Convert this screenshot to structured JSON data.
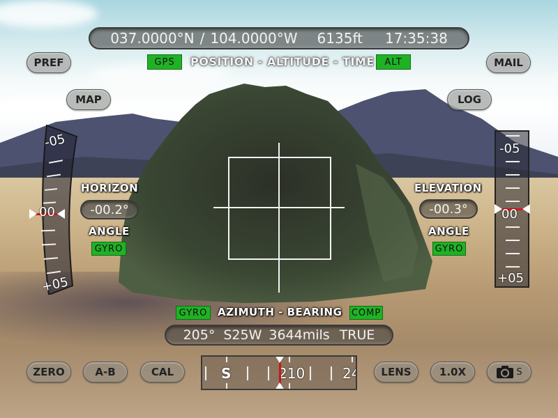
{
  "status_bar": {
    "latitude": "037.0000°N",
    "separator": "/",
    "longitude": "104.0000°W",
    "altitude": "6135ft",
    "time": "17:35:38"
  },
  "position_header": {
    "gps_tag": "GPS",
    "title": "POSITION - ALTITUDE - TIME",
    "alt_tag": "ALT"
  },
  "nav_buttons": {
    "pref": "PREF",
    "map": "MAP",
    "mail": "MAIL",
    "log": "LOG"
  },
  "horizon": {
    "title": "HORIZON",
    "value": "-00.2°",
    "subtitle": "ANGLE",
    "source_tag": "GYRO",
    "scale_labels": {
      "top": "-05",
      "center": "00",
      "bottom": "+05"
    },
    "angle_degrees": -0.2
  },
  "elevation": {
    "title": "ELEVATION",
    "value": "-00.3°",
    "subtitle": "ANGLE",
    "source_tag": "GYRO",
    "scale_labels": {
      "top": "-05",
      "center": "00",
      "bottom": "+05"
    },
    "angle_degrees": -0.3
  },
  "azimuth": {
    "gyro_tag": "GYRO",
    "title": "AZIMUTH - BEARING",
    "comp_tag": "COMP",
    "degrees": "205°",
    "quadrant": "S25W",
    "mils": "3644mils",
    "reference": "TRUE"
  },
  "compass_tape": {
    "labels": [
      "S",
      "210",
      "24"
    ],
    "heading_degrees": 205
  },
  "bottom_buttons": {
    "zero": "ZERO",
    "ab": "A-B",
    "cal": "CAL",
    "lens": "LENS",
    "zoom": "1.0X",
    "camera_suffix": "S"
  },
  "colors": {
    "tag_green": "#1fb225",
    "indicator_red": "#d21a1a"
  }
}
